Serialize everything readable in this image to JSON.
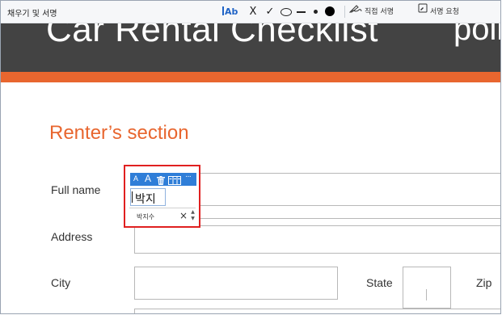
{
  "toolbar": {
    "title": "채우기 및 서명",
    "text_tool_label": "Ab",
    "cross_label": "X",
    "check_label": "✓",
    "sign_label": "직접 서명",
    "request_label": "서명 요청"
  },
  "document": {
    "banner_title": "Car Rental Checklist",
    "banner_right": "poli",
    "section_title": "Renter’s section",
    "labels": {
      "full_name": "Full name",
      "address": "Address",
      "city": "City",
      "state": "State",
      "zip": "Zip"
    }
  },
  "annotation": {
    "small_a": "A",
    "big_a": "A",
    "field_value": "박지",
    "suggestion": "박지수",
    "close": "×"
  }
}
